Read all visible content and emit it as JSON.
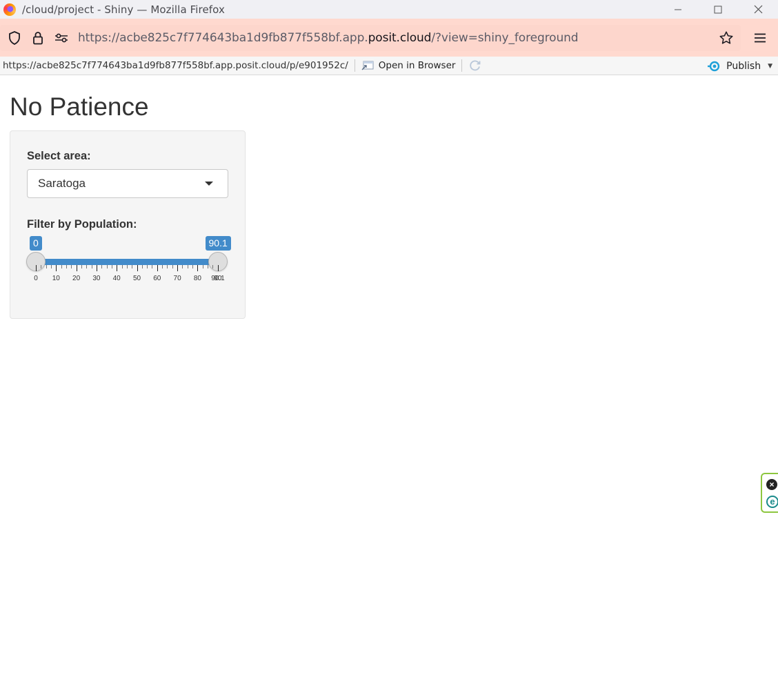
{
  "window": {
    "title": "/cloud/project - Shiny — Mozilla Firefox"
  },
  "browser": {
    "url_prefix": "https://acbe825c7f774643ba1d9fb877f558bf.app.",
    "url_domain": "posit.cloud",
    "url_suffix": "/?view=shiny_foreground"
  },
  "viewer": {
    "url": "https://acbe825c7f774643ba1d9fb877f558bf.app.posit.cloud/p/e901952c/",
    "open_in_browser": "Open in Browser",
    "publish": "Publish"
  },
  "app": {
    "title": "No Patience",
    "select": {
      "label": "Select area:",
      "value": "Saratoga"
    },
    "slider": {
      "label": "Filter by Population:",
      "min": 0,
      "max": 90.1,
      "from": 0,
      "to": 90.1,
      "from_label": "0",
      "to_label": "90.1",
      "ticks": [
        "0",
        "10",
        "20",
        "30",
        "40",
        "50",
        "60",
        "70",
        "80",
        "90",
        "90.1"
      ]
    }
  }
}
